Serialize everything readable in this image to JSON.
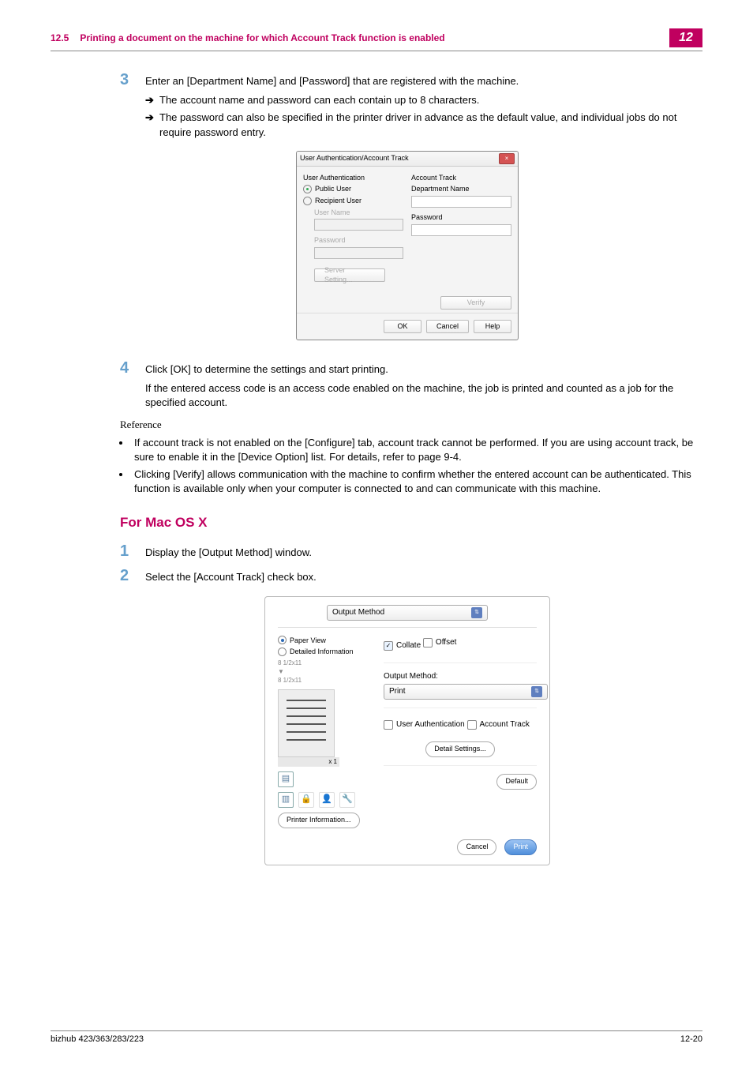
{
  "header": {
    "section_number": "12.5",
    "title": "Printing a document on the machine for which Account Track function is enabled",
    "badge": "12"
  },
  "step3": {
    "num": "3",
    "text": "Enter an [Department Name] and [Password] that are registered with the machine.",
    "sub1": "The account name and password can each contain up to 8 characters.",
    "sub2": "The password can also be specified in the printer driver in advance as the default value, and individual jobs do not require password entry."
  },
  "win_dialog": {
    "title": "User Authentication/Account Track",
    "ua_heading": "User Authentication",
    "public_user": "Public User",
    "recipient_user": "Recipient User",
    "user_name": "User Name",
    "password_ua": "Password",
    "server_setting": "Server Setting...",
    "at_heading": "Account Track",
    "dept_name": "Department Name",
    "password_at": "Password",
    "verify": "Verify",
    "ok": "OK",
    "cancel": "Cancel",
    "help": "Help",
    "close_glyph": "×"
  },
  "step4": {
    "num": "4",
    "text": "Click [OK] to determine the settings and start printing.",
    "para": "If the entered access code is an access code enabled on the machine, the job is printed and counted as a job for the specified account."
  },
  "reference": {
    "label": "Reference",
    "b1": "If account track is not enabled on the [Configure] tab, account track cannot be performed. If you are using account track, be sure to enable it in the [Device Option] list. For details, refer to page 9-4.",
    "b2": "Clicking [Verify] allows communication with the machine to confirm whether the entered account can be authenticated. This function is available only when your computer is connected to and can communicate with this machine."
  },
  "mac": {
    "heading": "For Mac OS X",
    "s1_num": "1",
    "s1_text": "Display the [Output Method] window.",
    "s2_num": "2",
    "s2_text": "Select the [Account Track] check box."
  },
  "mac_dialog": {
    "top_select": "Output Method",
    "paper_view": "Paper View",
    "detailed_info": "Detailed Information",
    "dimA": "8 1/2x11",
    "dimB": "8 1/2x11",
    "x1": "x 1",
    "printer_info": "Printer Information...",
    "collate": "Collate",
    "offset": "Offset",
    "output_method_lbl": "Output Method:",
    "print_opt": "Print",
    "user_auth": "User Authentication",
    "account_track": "Account Track",
    "detail_settings": "Detail Settings...",
    "defaultb": "Default",
    "cancel": "Cancel",
    "print": "Print",
    "arrow_glyph": "▼",
    "updown_glyph": "⇅",
    "check_glyph": "✓"
  },
  "footer": {
    "left": "bizhub 423/363/283/223",
    "right": "12-20"
  }
}
